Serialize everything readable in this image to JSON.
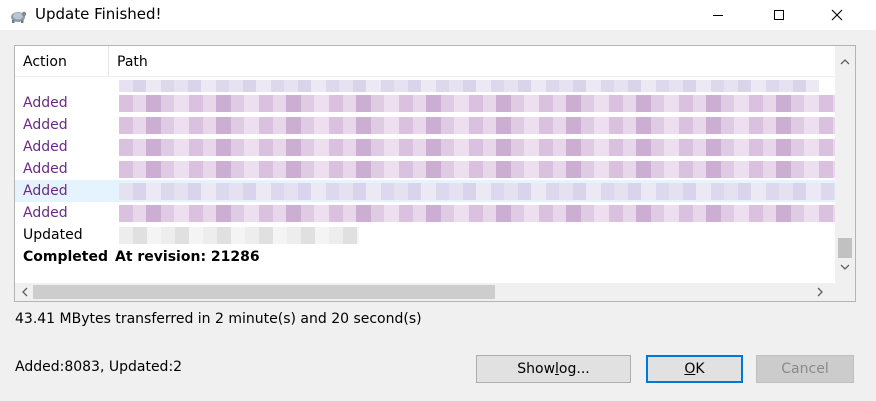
{
  "window": {
    "title": "Update Finished!",
    "app_icon": "tortoise-icon"
  },
  "list": {
    "columns": [
      "Action",
      "Path"
    ],
    "rows": [
      {
        "action": "Added",
        "path": "",
        "state": "added"
      },
      {
        "action": "Added",
        "path": "",
        "state": "added"
      },
      {
        "action": "Added",
        "path": "",
        "state": "added"
      },
      {
        "action": "Added",
        "path": "",
        "state": "added"
      },
      {
        "action": "Added",
        "path": "",
        "state": "added",
        "selected": true
      },
      {
        "action": "Added",
        "path": "",
        "state": "added"
      },
      {
        "action": "Updated",
        "path": "",
        "state": "updated"
      },
      {
        "action": "Completed",
        "path": "At revision: 21286",
        "state": "completed"
      }
    ]
  },
  "status": {
    "transfer": "43.41 MBytes transferred in 2 minute(s) and 20 second(s)",
    "summary": "Added:8083, Updated:2"
  },
  "buttons": {
    "show_log_prefix": "Show ",
    "show_log_underlined": "l",
    "show_log_suffix": "og...",
    "ok_underlined": "O",
    "ok_suffix": "K",
    "cancel": "Cancel"
  },
  "colors": {
    "added_text": "#6b2a83",
    "accent": "#0078d7",
    "selected_row": "#e5f3ff"
  }
}
